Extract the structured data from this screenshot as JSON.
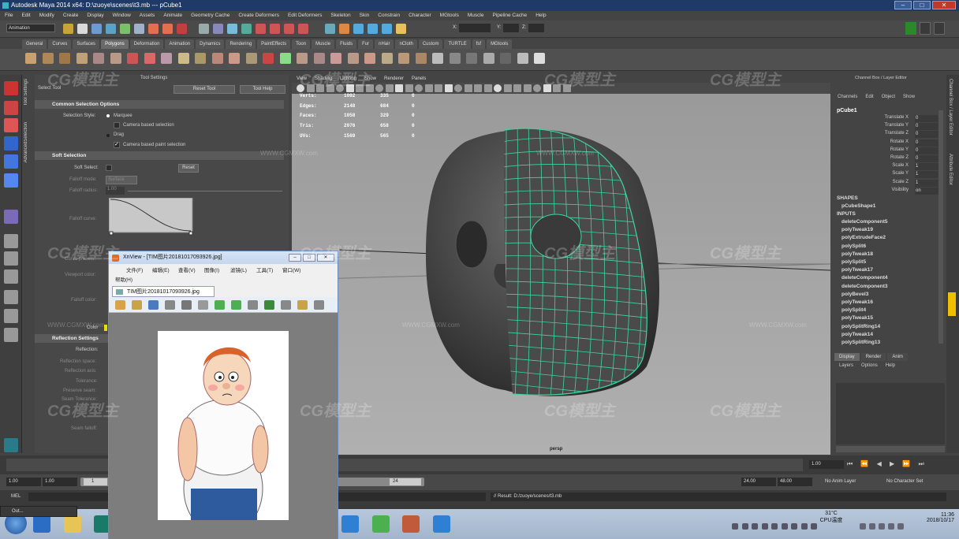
{
  "window": {
    "title": "Autodesk Maya 2014 x64: D:\\zuoye\\scenes\\t3.mb   ---   pCube1"
  },
  "menubar": [
    "File",
    "Edit",
    "Modify",
    "Create",
    "Display",
    "Window",
    "Assets",
    "Animate",
    "Geometry Cache",
    "Create Deformers",
    "Edit Deformers",
    "Skeleton",
    "Skin",
    "Constrain",
    "Character",
    "MGtools",
    "Muscle",
    "Pipeline Cache",
    "Help"
  ],
  "status_line": {
    "menu_set": "Animation",
    "x_label": "X:",
    "y_label": "Y:",
    "z_label": "Z:"
  },
  "shelf_tabs": [
    "General",
    "Curves",
    "Surfaces",
    "Polygons",
    "Deformation",
    "Animation",
    "Dynamics",
    "Rendering",
    "PaintEffects",
    "Toon",
    "Muscle",
    "Fluids",
    "Fur",
    "nHair",
    "nCloth",
    "Custom",
    "TURTLE",
    "fsf",
    "MGtools"
  ],
  "shelf_active": "Polygons",
  "side_tabs": [
    "Tool Settings",
    "AdvancedSelection"
  ],
  "tool_settings": {
    "panel_title": "Tool Settings",
    "tool_name": "Select Tool",
    "reset_tool": "Reset Tool",
    "tool_help": "Tool Help",
    "common_header": "Common Selection Options",
    "selection_style_label": "Selection Style:",
    "marquee": "Marquee",
    "camera_based_selection": "Camera based selection",
    "drag": "Drag",
    "camera_based_paint": "Camera based paint selection",
    "soft_header": "Soft Selection",
    "soft_select_label": "Soft Select:",
    "reset": "Reset",
    "falloff_mode_label": "Falloff mode:",
    "falloff_mode_value": "Surface",
    "falloff_radius_label": "Falloff radius:",
    "falloff_radius_value": "1.00",
    "falloff_curve_label": "Falloff curve:",
    "curve_presets_label": "Curve presets:",
    "viewport_color_label": "Viewport color:",
    "falloff_color_label": "Falloff color:",
    "color_label": "Color",
    "reflection_header": "Reflection Settings",
    "reflection_label": "Reflection:",
    "reflection_space_label": "Reflection space:",
    "reflection_axis_label": "Reflection axis:",
    "tolerance_label": "Tolerance:",
    "preserve_seam_label": "Preserve seam:",
    "seam_tolerance_label": "Seam Tolerance:",
    "seam_falloff_label": "Seam falloff:"
  },
  "viewport": {
    "menus": [
      "View",
      "Shading",
      "Lighting",
      "Show",
      "Renderer",
      "Panels"
    ],
    "camera": "persp",
    "hud": [
      {
        "label": "Verts:",
        "a": "1092",
        "b": "335",
        "c": "0"
      },
      {
        "label": "Edges:",
        "a": "2148",
        "b": "684",
        "c": "0"
      },
      {
        "label": "Faces:",
        "a": "1058",
        "b": "329",
        "c": "0"
      },
      {
        "label": "Tris:",
        "a": "2076",
        "b": "658",
        "c": "0"
      },
      {
        "label": "UVs:",
        "a": "1569",
        "b": "565",
        "c": "0"
      }
    ]
  },
  "channel_box": {
    "title": "Channel Box / Layer Editor",
    "tabs": [
      "Channels",
      "Edit",
      "Object",
      "Show"
    ],
    "object": "pCube1",
    "attributes": [
      {
        "name": "Translate X",
        "value": "0"
      },
      {
        "name": "Translate Y",
        "value": "0"
      },
      {
        "name": "Translate Z",
        "value": "0"
      },
      {
        "name": "Rotate X",
        "value": "0"
      },
      {
        "name": "Rotate Y",
        "value": "0"
      },
      {
        "name": "Rotate Z",
        "value": "0"
      },
      {
        "name": "Scale X",
        "value": "1"
      },
      {
        "name": "Scale Y",
        "value": "1"
      },
      {
        "name": "Scale Z",
        "value": "1"
      },
      {
        "name": "Visibility",
        "value": "on"
      }
    ],
    "shapes_header": "SHAPES",
    "shape": "pCubeShape1",
    "inputs_header": "INPUTS",
    "inputs": [
      "deleteComponent5",
      "polyTweak19",
      "polyExtrudeFace2",
      "polySplit6",
      "polyTweak18",
      "polySplit5",
      "polyTweak17",
      "deleteComponent4",
      "deleteComponent3",
      "polyBevel3",
      "polyTweak16",
      "polySplit4",
      "polyTweak15",
      "polySplitRing14",
      "polyTweak14",
      "polySplitRing13"
    ]
  },
  "layer_editor": {
    "tabs": [
      "Display",
      "Render",
      "Anim"
    ],
    "menu": [
      "Layers",
      "Options",
      "Help"
    ]
  },
  "right_strip": [
    "Channel Box / Layer Editor",
    "Attribute Editor"
  ],
  "time_range": {
    "start": "1.00",
    "playback_start": "1.00",
    "current_frame": "24",
    "playback_end": "24.00",
    "end": "48.00",
    "right_frame": "1.00",
    "anim_layer": "No Anim Layer",
    "character_set": "No Character Set",
    "range_box": "1"
  },
  "command_line": {
    "label": "MEL",
    "result": "// Result: D:/zuoye/scenes/t3.mb"
  },
  "xnview": {
    "title": "XnView - [TIM图片20181017093926.jpg]",
    "menu_row1": [
      "文件(F)",
      "编辑(E)",
      "查看(V)",
      "图像(I)",
      "滤镜(L)",
      "工具(T)",
      "窗口(W)"
    ],
    "menu_row2": [
      "帮助(H)"
    ],
    "tab": "TIM图片20181017093926.jpg"
  },
  "taskbar": {
    "outliner_label": "Out...",
    "temperature": "31°C",
    "cpu_label": "CPU温度",
    "time": "11:36",
    "date": "2018/10/17"
  },
  "watermarks": [
    "CG模型主",
    "WWW.CGMXW.com"
  ],
  "colors": {
    "maya_bg": "#444444",
    "viewport_bg": "#a5a5a5",
    "wireframe": "#3ed6a0",
    "mesh": "#4a4a4a",
    "title_blue": "#1f3a66"
  }
}
